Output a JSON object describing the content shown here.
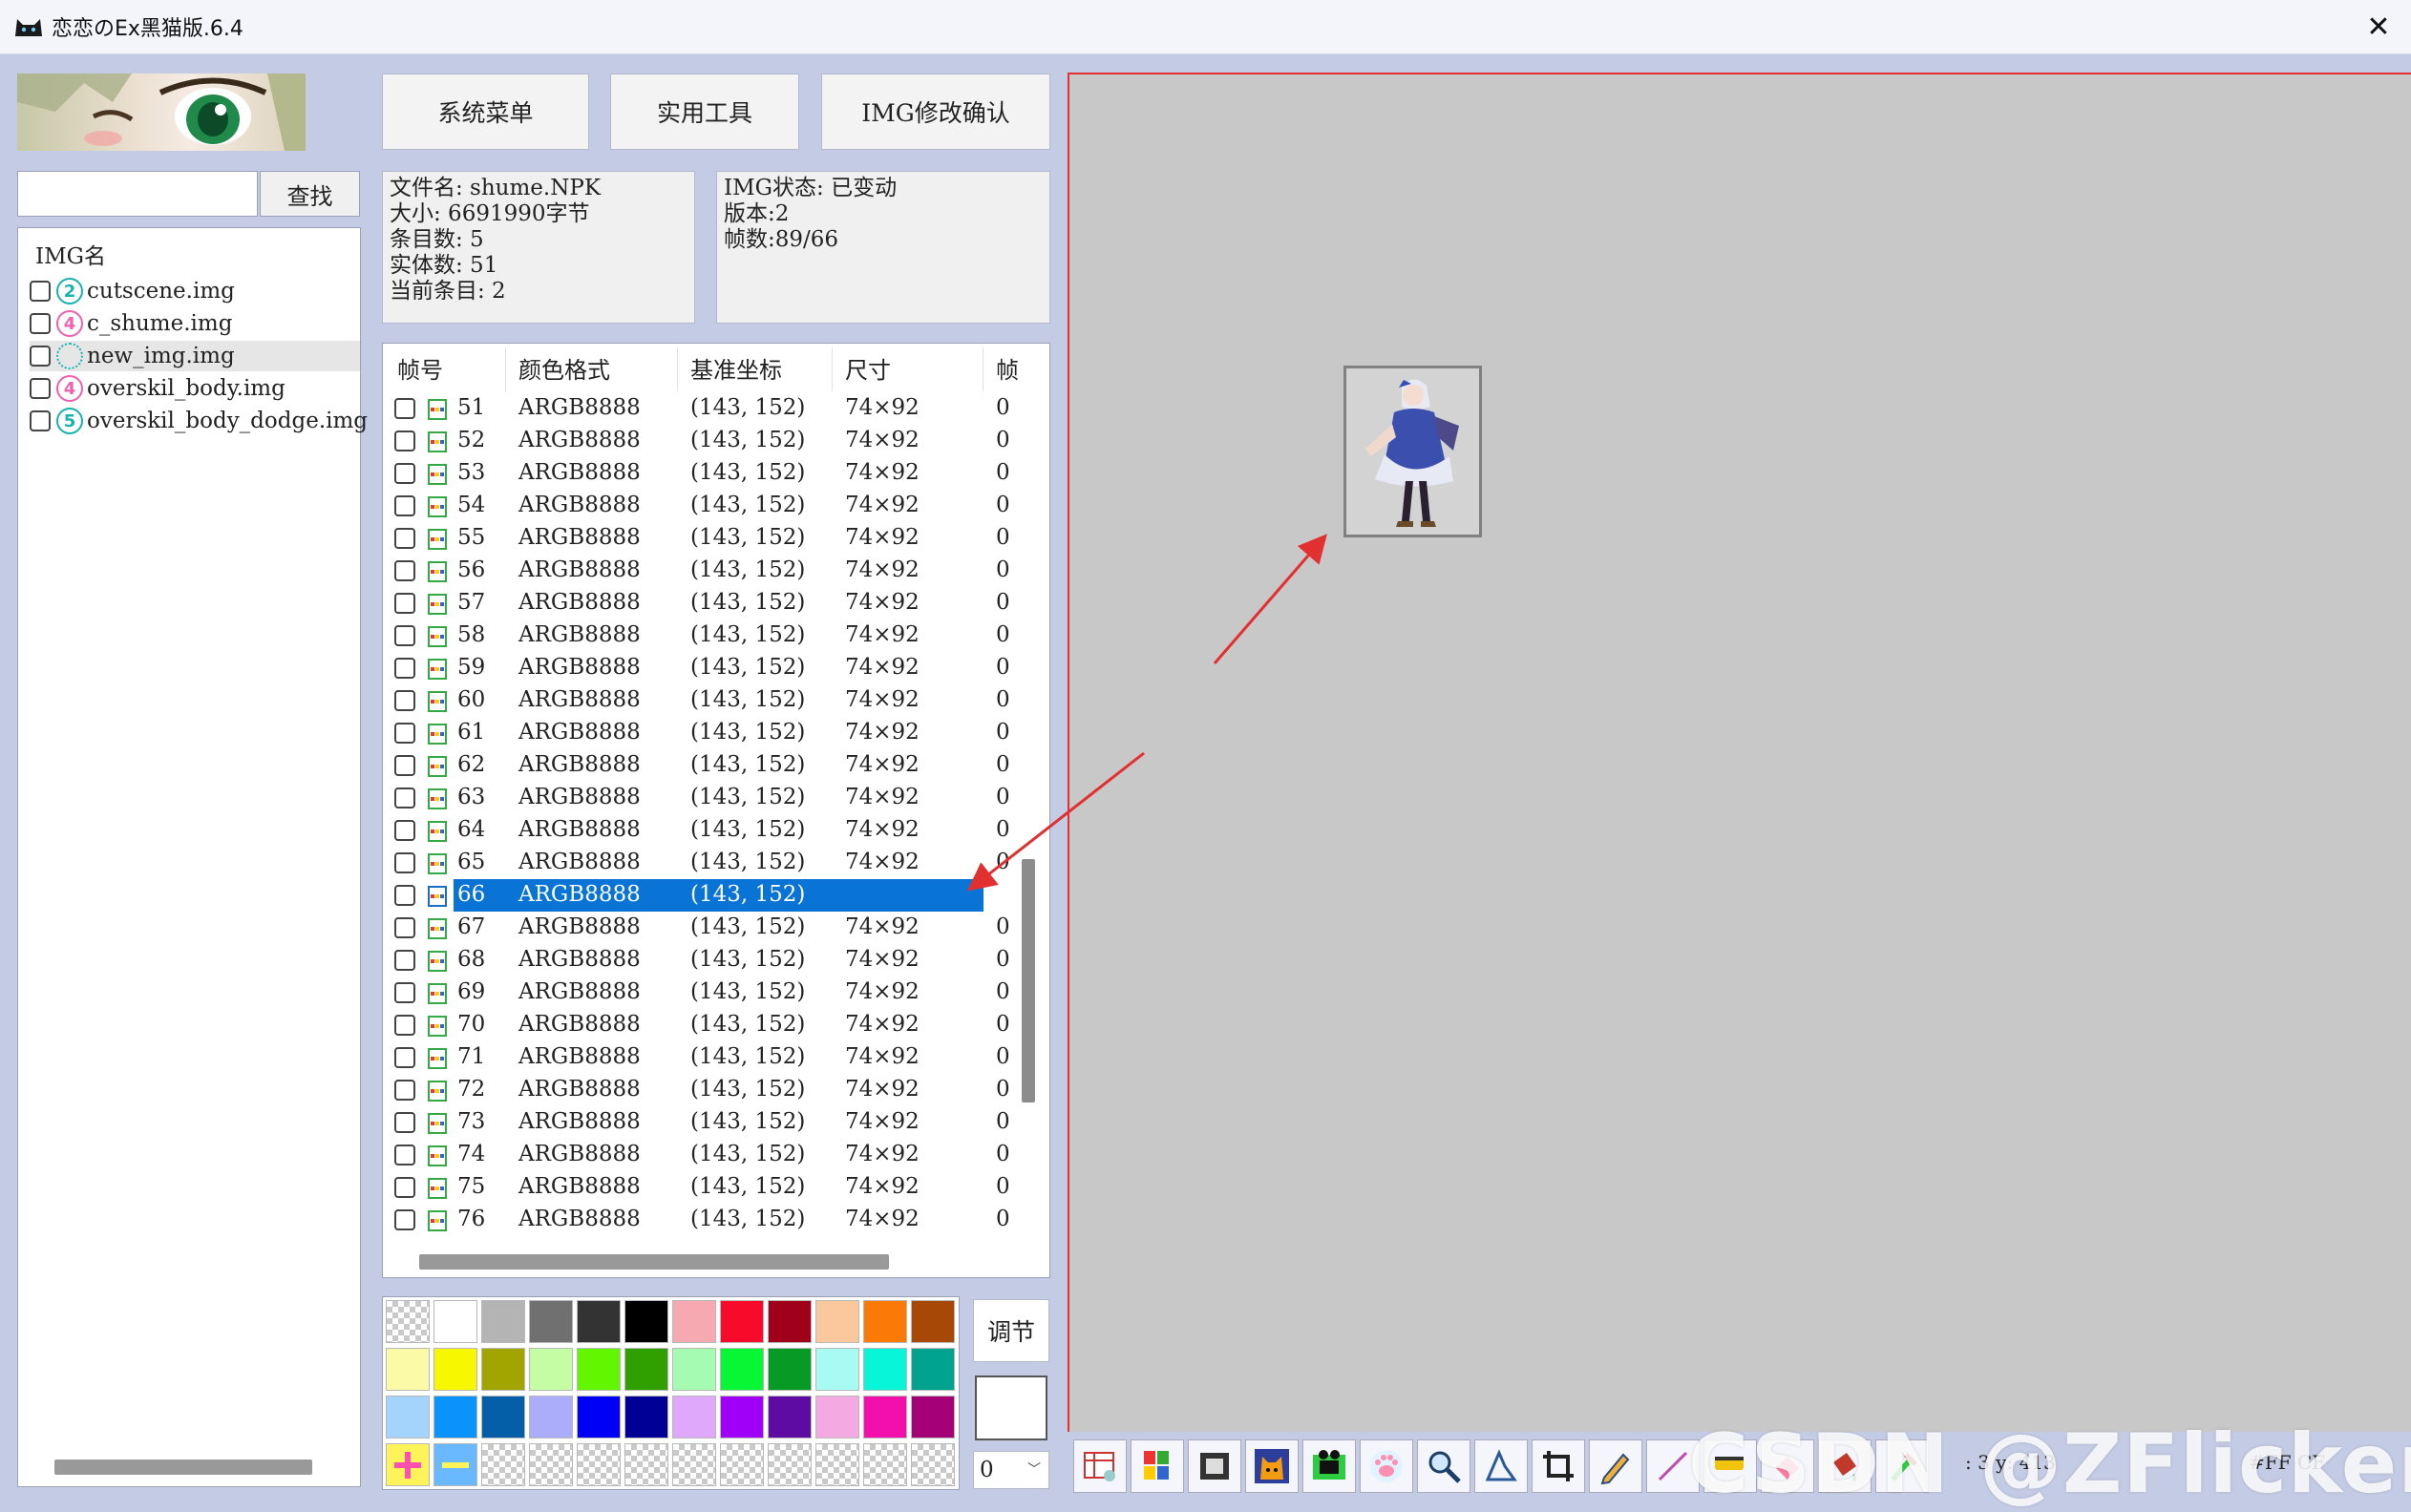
{
  "window": {
    "title": "恋恋のEx黑猫版.6.4",
    "close_glyph": "✕"
  },
  "search": {
    "value": "",
    "button_label": "查找"
  },
  "img_list": {
    "header": "IMG名",
    "items": [
      {
        "name": "cutscene.img",
        "badge": "2",
        "badge_color": "#17b3b0",
        "selected": false
      },
      {
        "name": "c_shume.img",
        "badge": "4",
        "badge_color": "#f060b0",
        "selected": false
      },
      {
        "name": "new_img.img",
        "badge": "",
        "badge_color": "#17b3b0",
        "selected": true
      },
      {
        "name": "overskil_body.img",
        "badge": "4",
        "badge_color": "#f060b0",
        "selected": false
      },
      {
        "name": "overskil_body_dodge.img",
        "badge": "5",
        "badge_color": "#17b3b0",
        "selected": false
      }
    ]
  },
  "top_buttons": {
    "system_menu": "系统菜单",
    "tools": "实用工具",
    "img_confirm": "IMG修改确认"
  },
  "file_info": {
    "filename": "文件名: shume.NPK",
    "size": "大小: 6691990字节",
    "entries": "条目数: 5",
    "entities": "实体数: 51",
    "current_entry": "当前条目: 2"
  },
  "img_info": {
    "status": "IMG状态: 已变动",
    "version": "版本:2",
    "frames": "帧数:89/66"
  },
  "frame_table": {
    "columns": [
      "帧号",
      "颜色格式",
      "基准坐标",
      "尺寸",
      "帧"
    ],
    "rows": [
      {
        "id": "51",
        "format": "ARGB8888",
        "coord": "(143, 152)",
        "size": "74×92",
        "extra": "0"
      },
      {
        "id": "52",
        "format": "ARGB8888",
        "coord": "(143, 152)",
        "size": "74×92",
        "extra": "0"
      },
      {
        "id": "53",
        "format": "ARGB8888",
        "coord": "(143, 152)",
        "size": "74×92",
        "extra": "0"
      },
      {
        "id": "54",
        "format": "ARGB8888",
        "coord": "(143, 152)",
        "size": "74×92",
        "extra": "0"
      },
      {
        "id": "55",
        "format": "ARGB8888",
        "coord": "(143, 152)",
        "size": "74×92",
        "extra": "0"
      },
      {
        "id": "56",
        "format": "ARGB8888",
        "coord": "(143, 152)",
        "size": "74×92",
        "extra": "0"
      },
      {
        "id": "57",
        "format": "ARGB8888",
        "coord": "(143, 152)",
        "size": "74×92",
        "extra": "0"
      },
      {
        "id": "58",
        "format": "ARGB8888",
        "coord": "(143, 152)",
        "size": "74×92",
        "extra": "0"
      },
      {
        "id": "59",
        "format": "ARGB8888",
        "coord": "(143, 152)",
        "size": "74×92",
        "extra": "0"
      },
      {
        "id": "60",
        "format": "ARGB8888",
        "coord": "(143, 152)",
        "size": "74×92",
        "extra": "0"
      },
      {
        "id": "61",
        "format": "ARGB8888",
        "coord": "(143, 152)",
        "size": "74×92",
        "extra": "0"
      },
      {
        "id": "62",
        "format": "ARGB8888",
        "coord": "(143, 152)",
        "size": "74×92",
        "extra": "0"
      },
      {
        "id": "63",
        "format": "ARGB8888",
        "coord": "(143, 152)",
        "size": "74×92",
        "extra": "0"
      },
      {
        "id": "64",
        "format": "ARGB8888",
        "coord": "(143, 152)",
        "size": "74×92",
        "extra": "0"
      },
      {
        "id": "65",
        "format": "ARGB8888",
        "coord": "(143, 152)",
        "size": "74×92",
        "extra": "0"
      },
      {
        "id": "66",
        "format": "ARGB8888",
        "coord": "(143, 152)",
        "size": "",
        "extra": "",
        "selected": true
      },
      {
        "id": "67",
        "format": "ARGB8888",
        "coord": "(143, 152)",
        "size": "74×92",
        "extra": "0"
      },
      {
        "id": "68",
        "format": "ARGB8888",
        "coord": "(143, 152)",
        "size": "74×92",
        "extra": "0"
      },
      {
        "id": "69",
        "format": "ARGB8888",
        "coord": "(143, 152)",
        "size": "74×92",
        "extra": "0"
      },
      {
        "id": "70",
        "format": "ARGB8888",
        "coord": "(143, 152)",
        "size": "74×92",
        "extra": "0"
      },
      {
        "id": "71",
        "format": "ARGB8888",
        "coord": "(143, 152)",
        "size": "74×92",
        "extra": "0"
      },
      {
        "id": "72",
        "format": "ARGB8888",
        "coord": "(143, 152)",
        "size": "74×92",
        "extra": "0"
      },
      {
        "id": "73",
        "format": "ARGB8888",
        "coord": "(143, 152)",
        "size": "74×92",
        "extra": "0"
      },
      {
        "id": "74",
        "format": "ARGB8888",
        "coord": "(143, 152)",
        "size": "74×92",
        "extra": "0"
      },
      {
        "id": "75",
        "format": "ARGB8888",
        "coord": "(143, 152)",
        "size": "74×92",
        "extra": "0"
      },
      {
        "id": "76",
        "format": "ARGB8888",
        "coord": "(143, 152)",
        "size": "74×92",
        "extra": "0"
      }
    ]
  },
  "palette": {
    "colors": [
      "checker",
      "#ffffff",
      "#b4b4b4",
      "#707070",
      "#333333",
      "#000000",
      "#f7a9b2",
      "#f70a2a",
      "#a1001b",
      "#fbc79d",
      "#fb7a07",
      "#a84806",
      "#fbfba7",
      "#f7f700",
      "#a2a500",
      "#c4fda4",
      "#62f700",
      "#2fa000",
      "#a5fbb1",
      "#08f734",
      "#079b25",
      "#a8fbf2",
      "#08f5d9",
      "#00a290",
      "#a4d3fb",
      "#0a93fb",
      "#045fa8",
      "#abacfa",
      "#0000f7",
      "#000097",
      "#dfa8fb",
      "#a000f7",
      "#5d0ba3",
      "#f5a9e2",
      "#f20fab",
      "#a50078",
      "plus",
      "minus",
      "checker",
      "checker",
      "checker",
      "checker",
      "checker",
      "checker",
      "checker",
      "checker",
      "checker",
      "checker"
    ],
    "adjust_label": "调节",
    "number_value": "0"
  },
  "status": {
    "coords": ": 3  y: 413",
    "hex": "#FF CF"
  },
  "watermark": "CSDN @ZFlicker",
  "tools": [
    "table-icon",
    "palette-grid-icon",
    "frame-icon",
    "cat-icon",
    "film-icon",
    "paw-icon",
    "magnify-icon",
    "select-icon",
    "crop-icon",
    "pencil-icon",
    "line-icon",
    "highlighter-icon",
    "eraser-icon",
    "bucket-icon",
    "picker-icon"
  ]
}
